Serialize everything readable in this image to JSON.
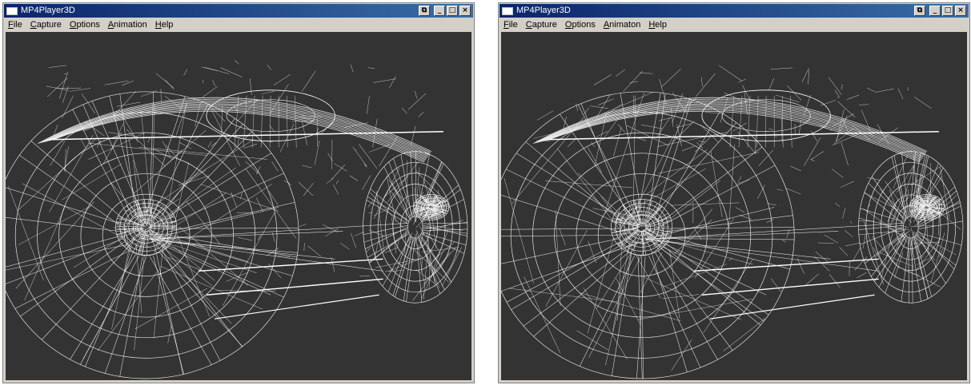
{
  "windows": [
    {
      "title": "MP4Player3D",
      "menu": [
        "File",
        "Capture",
        "Options",
        "Animation",
        "Help"
      ],
      "controls": {
        "restore": "⧉",
        "minimize": "_",
        "maximize": "□",
        "close": "×"
      }
    },
    {
      "title": "MP4Player3D",
      "menu": [
        "File",
        "Capture",
        "Options",
        "Animaton",
        "Help"
      ],
      "controls": {
        "restore": "⧉",
        "minimize": "_",
        "maximize": "□",
        "close": "×"
      }
    }
  ],
  "colors": {
    "viewport_bg": "#333333",
    "wireframe": "#ffffff",
    "titlebar": "#0a246a"
  },
  "icons": {
    "app": "window-icon"
  }
}
